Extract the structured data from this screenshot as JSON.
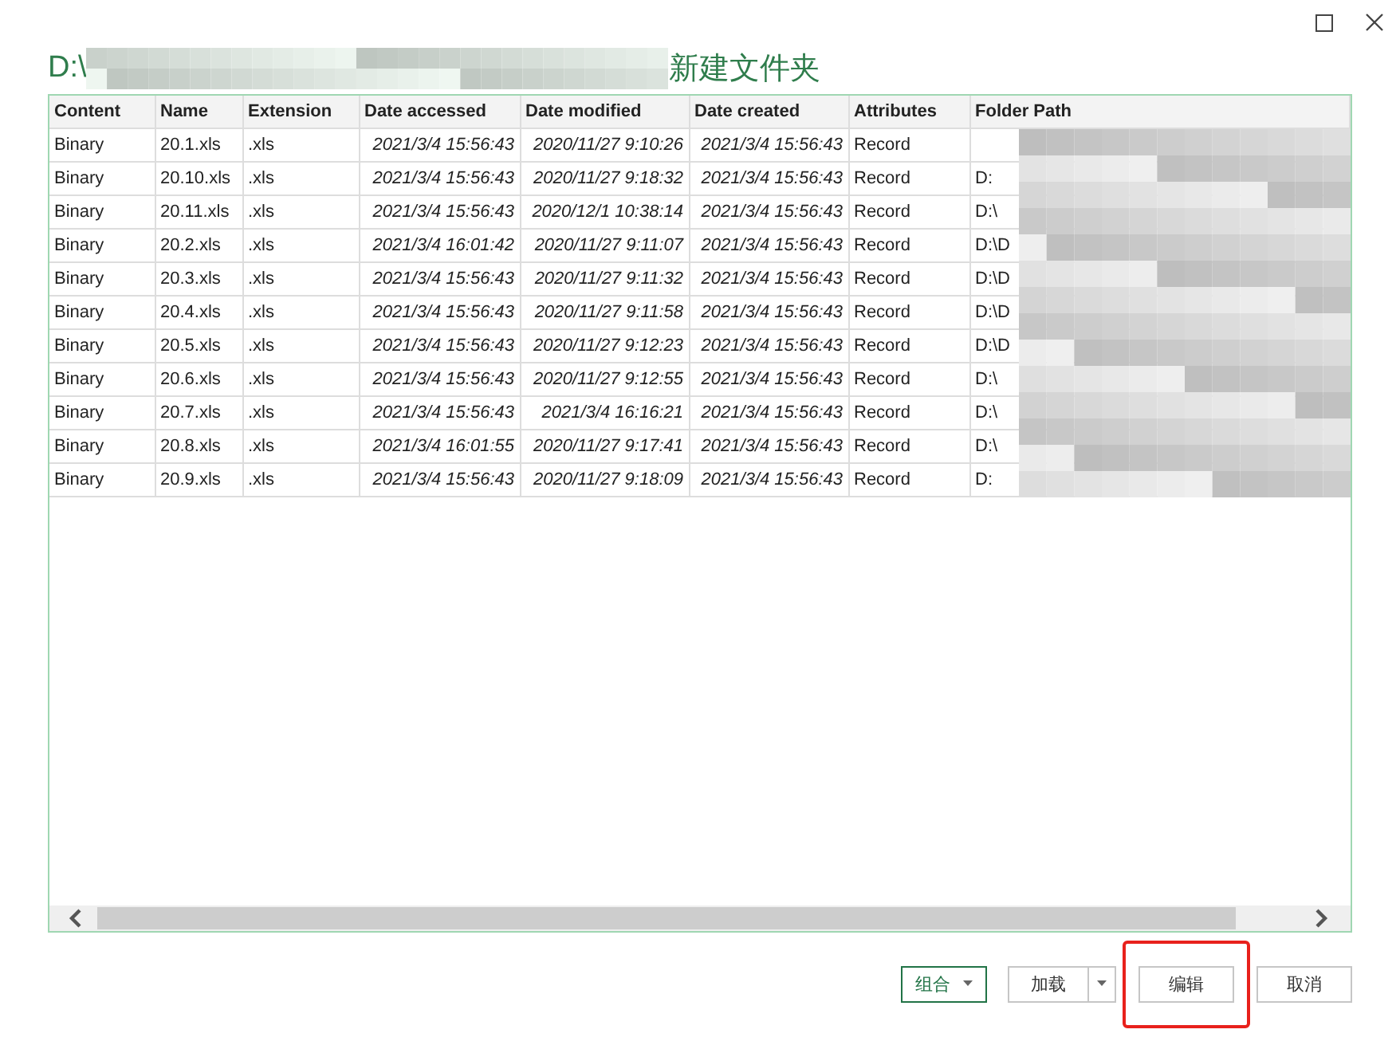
{
  "window": {
    "title_start": "D:\\",
    "title_end": "新建文件夹"
  },
  "table": {
    "columns": [
      "Content",
      "Name",
      "Extension",
      "Date accessed",
      "Date modified",
      "Date created",
      "Attributes",
      "Folder Path"
    ],
    "rows": [
      [
        "Binary",
        "20.1.xls",
        ".xls",
        "2021/3/4 15:56:43",
        "2020/11/27 9:10:26",
        "2021/3/4 15:56:43",
        "Record"
      ],
      [
        "Binary",
        "20.10.xls",
        ".xls",
        "2021/3/4 15:56:43",
        "2020/11/27 9:18:32",
        "2021/3/4 15:56:43",
        "Record",
        "D:"
      ],
      [
        "Binary",
        "20.11.xls",
        ".xls",
        "2021/3/4 15:56:43",
        "2020/12/1 10:38:14",
        "2021/3/4 15:56:43",
        "Record",
        "D:\\"
      ],
      [
        "Binary",
        "20.2.xls",
        ".xls",
        "2021/3/4 16:01:42",
        "2020/11/27 9:11:07",
        "2021/3/4 15:56:43",
        "Record",
        "D:\\D"
      ],
      [
        "Binary",
        "20.3.xls",
        ".xls",
        "2021/3/4 15:56:43",
        "2020/11/27 9:11:32",
        "2021/3/4 15:56:43",
        "Record",
        "D:\\D"
      ],
      [
        "Binary",
        "20.4.xls",
        ".xls",
        "2021/3/4 15:56:43",
        "2020/11/27 9:11:58",
        "2021/3/4 15:56:43",
        "Record",
        "D:\\D"
      ],
      [
        "Binary",
        "20.5.xls",
        ".xls",
        "2021/3/4 15:56:43",
        "2020/11/27 9:12:23",
        "2021/3/4 15:56:43",
        "Record",
        "D:\\D"
      ],
      [
        "Binary",
        "20.6.xls",
        ".xls",
        "2021/3/4 15:56:43",
        "2020/11/27 9:12:55",
        "2021/3/4 15:56:43",
        "Record",
        "D:\\"
      ],
      [
        "Binary",
        "20.7.xls",
        ".xls",
        "2021/3/4 15:56:43",
        "2021/3/4 16:16:21",
        "2021/3/4 15:56:43",
        "Record",
        "D:\\"
      ],
      [
        "Binary",
        "20.8.xls",
        ".xls",
        "2021/3/4 16:01:55",
        "2020/11/27 9:17:41",
        "2021/3/4 15:56:43",
        "Record",
        "D:\\"
      ],
      [
        "Binary",
        "20.9.xls",
        ".xls",
        "2021/3/4 15:56:43",
        "2020/11/27 9:18:09",
        "2021/3/4 15:56:43",
        "Record",
        "D:"
      ]
    ]
  },
  "buttons": [
    {
      "label": "组合",
      "kind": "primary-split"
    },
    {
      "label": "加载",
      "kind": "split"
    },
    {
      "label": "编辑",
      "kind": "plain",
      "highlighted": true
    },
    {
      "label": "取消",
      "kind": "plain",
      "highlighted": false
    }
  ]
}
